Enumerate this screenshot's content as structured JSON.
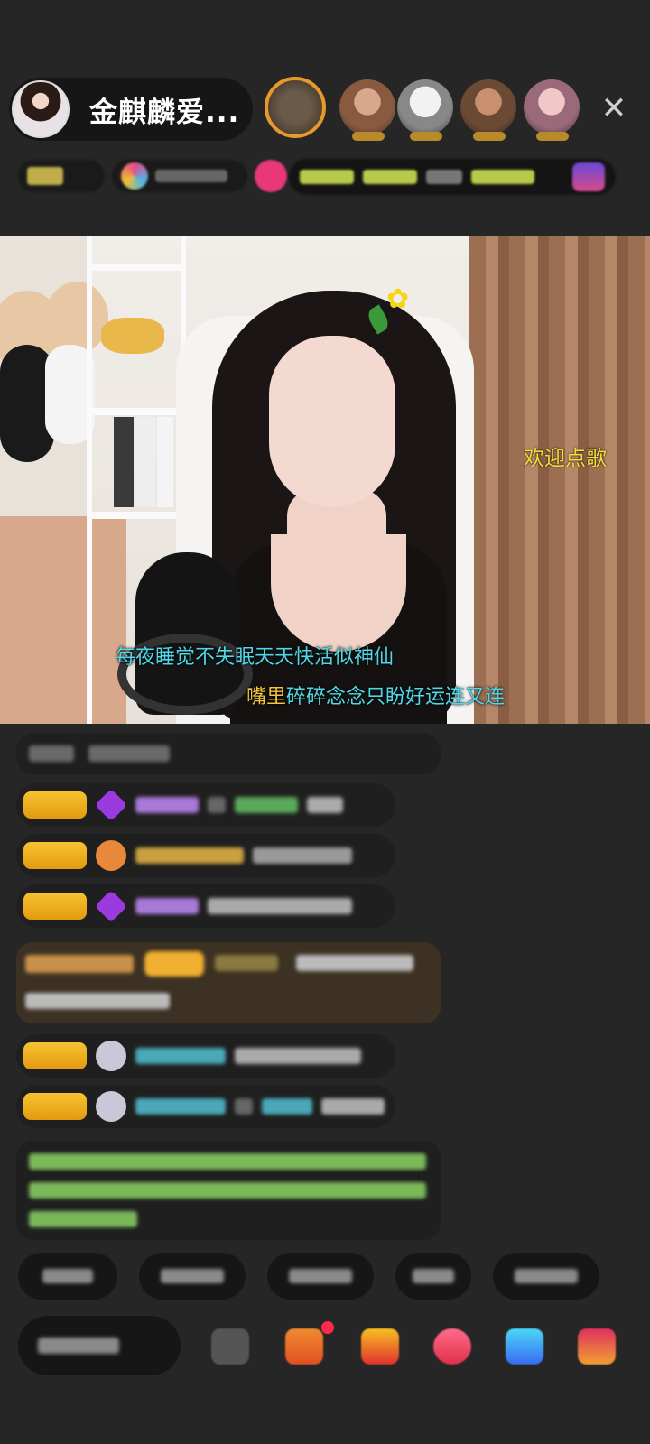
{
  "header": {
    "host_name": "金麒麟爱..."
  },
  "top_viewers": [
    {
      "icon": "viewer-avatar-1"
    },
    {
      "icon": "viewer-avatar-2"
    },
    {
      "icon": "viewer-avatar-3"
    },
    {
      "icon": "viewer-avatar-4"
    },
    {
      "icon": "viewer-avatar-5"
    }
  ],
  "close_glyph": "✕",
  "video": {
    "overlay_text": "欢迎点歌",
    "lyric_line_1": "每夜睡觉不失眠天天快活似神仙",
    "lyric_line_2_highlight": "嘴里",
    "lyric_line_2_rest": "碎碎念念只盼好运连又连"
  },
  "colors": {
    "background": "#262626",
    "lyric": "#4fd8e8",
    "lyric_highlight": "#f4c63a",
    "overlay_text": "#f3dc3a",
    "level_badge": "#f7c330",
    "gift_message_bg": "#3c3122"
  }
}
